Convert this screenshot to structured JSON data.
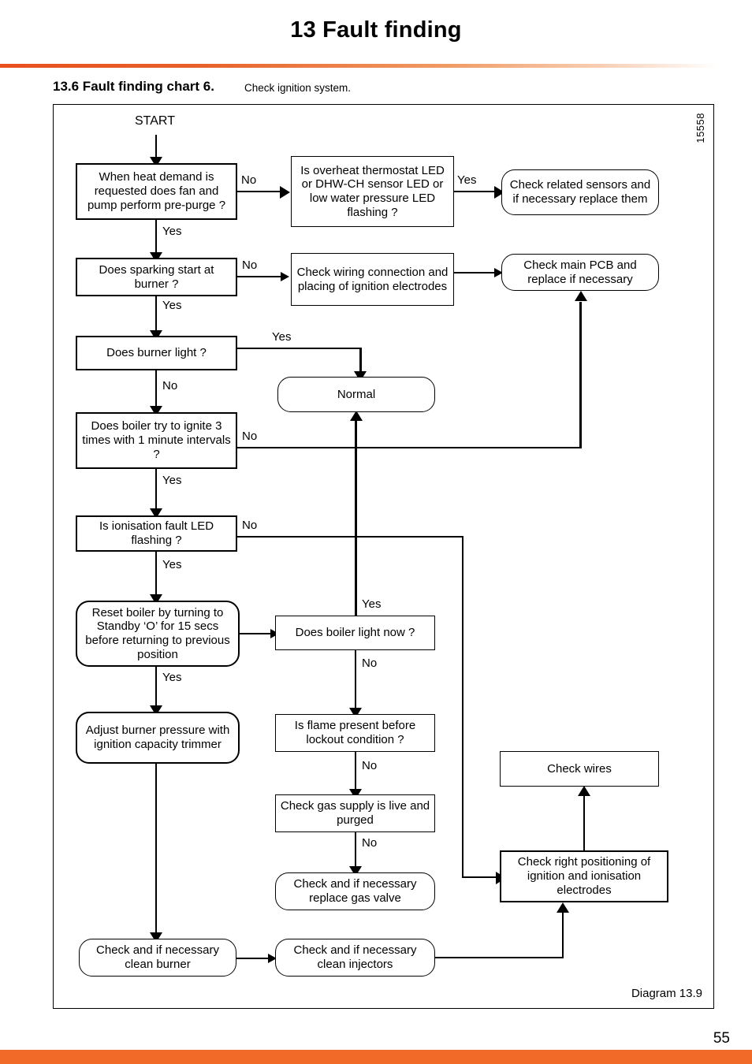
{
  "header": {
    "title": "13  Fault finding",
    "section_number": "13.6 Fault finding chart 6.",
    "section_subtitle": "Check ignition system."
  },
  "diagram": {
    "reference_number": "15558",
    "caption": "Diagram 13.9",
    "start_label": "START"
  },
  "footer": {
    "page_number": "55"
  },
  "colors": {
    "accent": "#f26a27",
    "rule_start": "#e8501e",
    "line": "#000000",
    "background": "#ffffff"
  },
  "chart_data": {
    "type": "diagram",
    "title": "Fault finding chart 6 - Check ignition system",
    "nodes": [
      {
        "id": "start",
        "label": "START",
        "shape": "text"
      },
      {
        "id": "n1",
        "label": "When heat demand is requested does fan and pump perform pre-purge ?",
        "shape": "rect"
      },
      {
        "id": "n2",
        "label": "Is overheat thermostat LED or DHW-CH sensor LED or low water pressure LED flashing ?",
        "shape": "rect"
      },
      {
        "id": "n3",
        "label": "Check related sensors and if necessary replace them",
        "shape": "rounded"
      },
      {
        "id": "n4",
        "label": "Does sparking start at burner ?",
        "shape": "rect"
      },
      {
        "id": "n5",
        "label": "Check wiring connection and placing of ignition electrodes",
        "shape": "rect"
      },
      {
        "id": "n6",
        "label": "Check main PCB and replace if necessary",
        "shape": "rounded"
      },
      {
        "id": "n7",
        "label": "Does burner light ?",
        "shape": "rect"
      },
      {
        "id": "n8",
        "label": "Normal",
        "shape": "rounded"
      },
      {
        "id": "n9",
        "label": "Does boiler try to ignite 3 times with 1 minute intervals ?",
        "shape": "rect"
      },
      {
        "id": "n10",
        "label": "Is ionisation fault LED flashing ?",
        "shape": "rect"
      },
      {
        "id": "n11",
        "label": "Reset boiler by turning to Standby 'O' for 15 secs before returning to previous position",
        "shape": "rounded"
      },
      {
        "id": "n12",
        "label": "Does boiler light now ?",
        "shape": "rect"
      },
      {
        "id": "n13",
        "label": "Adjust burner pressure with ignition capacity trimmer",
        "shape": "rounded"
      },
      {
        "id": "n14",
        "label": "Is flame present before lockout condition ?",
        "shape": "rect"
      },
      {
        "id": "n15",
        "label": "Check wires",
        "shape": "rect"
      },
      {
        "id": "n16",
        "label": "Check gas supply is live and purged",
        "shape": "rect"
      },
      {
        "id": "n17",
        "label": "Check right positioning of ignition and ionisation electrodes",
        "shape": "rect"
      },
      {
        "id": "n18",
        "label": "Check and if necessary replace gas valve",
        "shape": "rounded"
      },
      {
        "id": "n19",
        "label": "Check and if necessary clean burner",
        "shape": "rounded"
      },
      {
        "id": "n20",
        "label": "Check and if necessary clean injectors",
        "shape": "rounded"
      }
    ],
    "edges": [
      {
        "from": "start",
        "to": "n1",
        "label": ""
      },
      {
        "from": "n1",
        "to": "n2",
        "label": "No"
      },
      {
        "from": "n1",
        "to": "n4",
        "label": "Yes"
      },
      {
        "from": "n2",
        "to": "n3",
        "label": "Yes"
      },
      {
        "from": "n4",
        "to": "n5",
        "label": "No"
      },
      {
        "from": "n4",
        "to": "n7",
        "label": "Yes"
      },
      {
        "from": "n5",
        "to": "n6",
        "label": ""
      },
      {
        "from": "n7",
        "to": "n8",
        "label": "Yes"
      },
      {
        "from": "n7",
        "to": "n9",
        "label": "No"
      },
      {
        "from": "n9",
        "to": "n6",
        "label": "No"
      },
      {
        "from": "n9",
        "to": "n10",
        "label": "Yes"
      },
      {
        "from": "n10",
        "to": "n17",
        "label": "No"
      },
      {
        "from": "n10",
        "to": "n11",
        "label": "Yes"
      },
      {
        "from": "n11",
        "to": "n12",
        "label": ""
      },
      {
        "from": "n11",
        "to": "n13",
        "label": "Yes"
      },
      {
        "from": "n12",
        "to": "n8",
        "label": "Yes"
      },
      {
        "from": "n12",
        "to": "n14",
        "label": "No"
      },
      {
        "from": "n13",
        "to": "n19",
        "label": ""
      },
      {
        "from": "n14",
        "to": "n16",
        "label": "No"
      },
      {
        "from": "n16",
        "to": "n18",
        "label": "No"
      },
      {
        "from": "n17",
        "to": "n15",
        "label": ""
      },
      {
        "from": "n19",
        "to": "n20",
        "label": ""
      },
      {
        "from": "n20",
        "to": "n17",
        "label": ""
      }
    ],
    "edge_labels": [
      "No",
      "Yes"
    ]
  },
  "nodes": {
    "start": "START",
    "n1": "When heat demand is requested does fan and pump perform pre-purge ?",
    "n2": "Is overheat thermostat LED or DHW-CH sensor LED or low water pressure LED flashing ?",
    "n3": "Check related sensors and if necessary replace them",
    "n4": "Does sparking start at burner ?",
    "n5": "Check wiring connection and placing of ignition electrodes",
    "n6": "Check main PCB and replace if necessary",
    "n7": "Does burner light ?",
    "n8": "Normal",
    "n9": "Does boiler try to ignite 3 times with 1 minute intervals ?",
    "n10": "Is ionisation fault LED flashing ?",
    "n11": "Reset boiler by turning to Standby ‘O’ for 15 secs before returning to previous position",
    "n12": "Does boiler light now ?",
    "n13": "Adjust burner pressure with ignition capacity trimmer",
    "n14": "Is flame present before lockout condition ?",
    "n15": "Check wires",
    "n16": "Check gas supply is live and purged",
    "n17": "Check right positioning of ignition and ionisation electrodes",
    "n18": "Check and if necessary replace gas valve",
    "n19": "Check and if necessary clean burner",
    "n20": "Check and if necessary clean injectors"
  },
  "labels": {
    "e1_no": "No",
    "e1_yes": "Yes",
    "e2_yes": "Yes",
    "e4_no": "No",
    "e4_yes": "Yes",
    "e7_yes": "Yes",
    "e7_no": "No",
    "e9_no": "No",
    "e9_yes": "Yes",
    "e10_no": "No",
    "e10_yes": "Yes",
    "e11_yes": "Yes",
    "e12_yes": "Yes",
    "e12_no": "No",
    "e14_no": "No",
    "e16_no": "No"
  }
}
